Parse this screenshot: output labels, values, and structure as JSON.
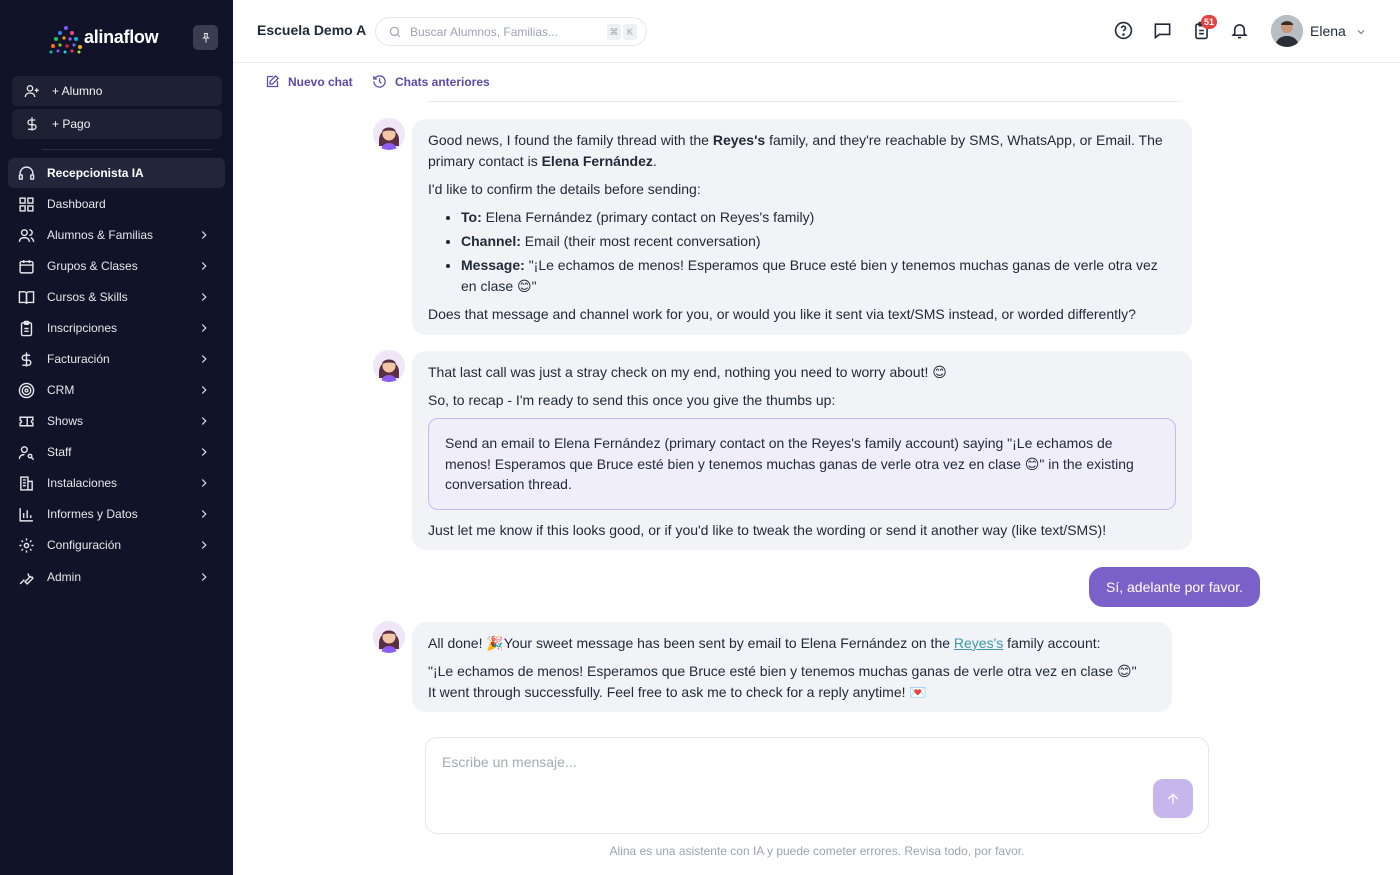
{
  "sidebar": {
    "brand": "alinaflow",
    "quick_actions": [
      {
        "label": "+ Alumno",
        "icon": "add-user-icon"
      },
      {
        "label": "+ Pago",
        "icon": "dollar-icon"
      }
    ],
    "items": [
      {
        "label": "Recepcionista IA",
        "icon": "headset-icon",
        "active": true
      },
      {
        "label": "Dashboard",
        "icon": "grid-icon"
      },
      {
        "label": "Alumnos & Familias",
        "icon": "users-icon"
      },
      {
        "label": "Grupos & Clases",
        "icon": "calendar-icon"
      },
      {
        "label": "Cursos & Skills",
        "icon": "book-icon"
      },
      {
        "label": "Inscripciones",
        "icon": "clipboard-icon"
      },
      {
        "label": "Facturación",
        "icon": "dollar-icon"
      },
      {
        "label": "CRM",
        "icon": "target-icon"
      },
      {
        "label": "Shows",
        "icon": "ticket-icon"
      },
      {
        "label": "Staff",
        "icon": "user-key-icon"
      },
      {
        "label": "Instalaciones",
        "icon": "building-icon"
      },
      {
        "label": "Informes y Datos",
        "icon": "bar-chart-icon"
      },
      {
        "label": "Configuración",
        "icon": "gear-icon"
      },
      {
        "label": "Admin",
        "icon": "wrench-icon"
      }
    ]
  },
  "header": {
    "school": "Escuela Demo A",
    "search_placeholder": "Buscar Alumnos, Familias...",
    "shortcut": [
      "⌘",
      "K"
    ],
    "notifications_badge": "51",
    "user_name": "Elena"
  },
  "subbar": {
    "new_chat": "Nuevo chat",
    "previous_chats": "Chats anteriores"
  },
  "messages": {
    "m1": {
      "p1_a": "Good news, I found the family thread with the ",
      "p1_b": "Reyes's",
      "p1_c": " family, and they're reachable by SMS, WhatsApp, or Email. The primary contact is ",
      "p1_d": "Elena Fernández",
      "p1_e": ".",
      "p2": "I'd like to confirm the details before sending:",
      "li1_k": "To:",
      "li1_v": " Elena Fernández (primary contact on Reyes's family)",
      "li2_k": "Channel:",
      "li2_v": " Email (their most recent conversation)",
      "li3_k": "Message:",
      "li3_v": " \"¡Le echamos de menos! Esperamos que Bruce esté bien y tenemos muchas ganas de verle otra vez en clase 😊\"",
      "p3": "Does that message and channel work for you, or would you like it sent via text/SMS instead, or worded differently?"
    },
    "m2": {
      "p1": "That last call was just a stray check on my end, nothing you need to worry about! 😊",
      "p2": "So, to recap - I'm ready to send this once you give the thumbs up:",
      "quote": "Send an email to Elena Fernández (primary contact on the Reyes's family account) saying \"¡Le echamos de menos! Esperamos que Bruce esté bien y tenemos muchas ganas de verle otra vez en clase 😊\" in the existing conversation thread.",
      "p3": "Just let me know if this looks good, or if you'd like to tweak the wording or send it another way (like text/SMS)!"
    },
    "user_reply": "Sí, adelante por favor.",
    "m3": {
      "p1_a": "All done! 🎉Your sweet message has been sent by email to Elena Fernández on the ",
      "p1_link": "Reyes's",
      "p1_b": " family account:",
      "p2_a": "\"¡Le echamos de menos! Esperamos que Bruce esté bien y tenemos muchas ganas de verle otra vez en clase 😊\"",
      "p2_b": "It went through successfully. Feel free to ask me to check for a reply anytime! 💌"
    }
  },
  "composer": {
    "placeholder": "Escribe un mensaje...",
    "disclaimer": "Alina es una asistente con IA y puede cometer errores. Revisa todo, por favor."
  },
  "colors": {
    "sidebar_bg": "#111428",
    "accent": "#7a60c9",
    "link": "#3b9aa8",
    "badge": "#e34242"
  }
}
